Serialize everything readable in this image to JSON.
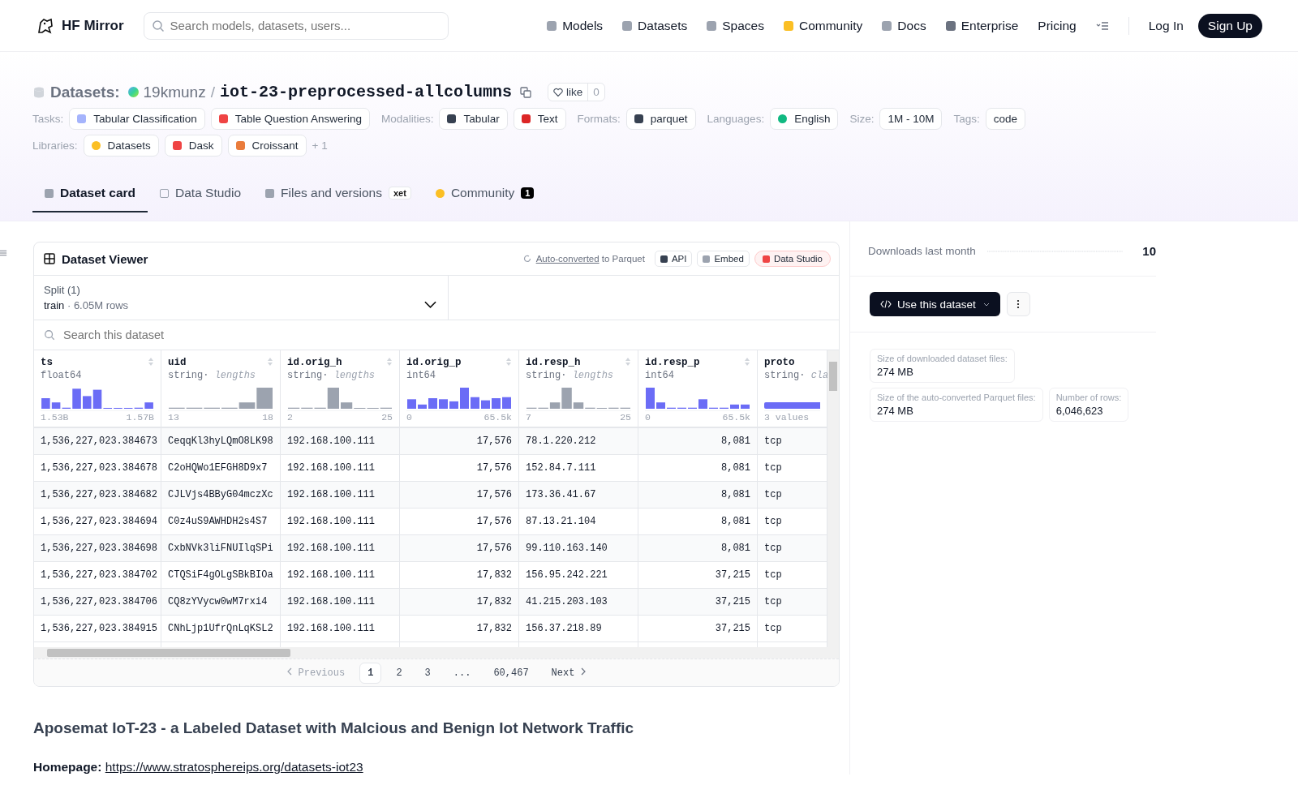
{
  "nav": {
    "brand": "HF Mirror",
    "search": {
      "placeholder": "Search models, datasets, users..."
    },
    "links": [
      {
        "label": "Models",
        "kind": "cube"
      },
      {
        "label": "Datasets",
        "kind": "db"
      },
      {
        "label": "Spaces",
        "kind": "grid"
      },
      {
        "label": "Community",
        "kind": "hand"
      },
      {
        "label": "Docs",
        "kind": "book"
      },
      {
        "label": "Enterprise",
        "kind": "ent"
      },
      {
        "label": "Pricing",
        "kind": "plain"
      }
    ],
    "login": "Log In",
    "signup": "Sign Up"
  },
  "repo": {
    "section": "Datasets:",
    "owner": "19kmunz",
    "separator": "/",
    "name": "iot-23-preprocessed-allcolumns",
    "like": "like",
    "likes": "0"
  },
  "tag_rows": [
    [
      {
        "label": "Tasks:",
        "tags": [
          {
            "label": "Tabular Classification",
            "kind": "classify"
          },
          {
            "label": "Table Question Answering",
            "kind": "tableqa"
          }
        ]
      },
      {
        "label": "Modalities:",
        "tags": [
          {
            "label": "Tabular",
            "kind": "tabular"
          },
          {
            "label": "Text",
            "kind": "text"
          }
        ]
      },
      {
        "label": "Formats:",
        "tags": [
          {
            "label": "parquet",
            "kind": "parquet"
          }
        ]
      },
      {
        "label": "Languages:",
        "tags": [
          {
            "label": "English",
            "kind": "globe"
          }
        ]
      },
      {
        "label": "Size:",
        "tags": [
          {
            "label": "1M - 10M",
            "kind": "plain"
          }
        ]
      },
      {
        "label": "Tags:",
        "tags": [
          {
            "label": "code",
            "kind": "plain"
          }
        ]
      }
    ],
    [
      {
        "label": "Libraries:",
        "tags": [
          {
            "label": "Datasets",
            "kind": "hug"
          },
          {
            "label": "Dask",
            "kind": "dask"
          },
          {
            "label": "Croissant",
            "kind": "croissant"
          }
        ],
        "more": "+ 1"
      }
    ]
  ],
  "tabs": [
    {
      "label": "Dataset card",
      "kind": "cube",
      "selected": true
    },
    {
      "label": "Data Studio",
      "kind": "table",
      "selected": false
    },
    {
      "label": "Files and versions",
      "kind": "files",
      "badge": "xet",
      "selected": false
    },
    {
      "label": "Community",
      "kind": "hand",
      "badge": "1",
      "selected": false
    }
  ],
  "viewer": {
    "title": "Dataset Viewer",
    "converted_link": "Auto-converted",
    "converted_text": "to Parquet",
    "buttons": [
      {
        "label": "API",
        "kind": "code"
      },
      {
        "label": "Embed",
        "kind": "embed"
      },
      {
        "label": "Data Studio",
        "kind": "studio"
      }
    ],
    "separator": "·",
    "split": {
      "label": "Split (1)",
      "name": "train",
      "rows": "6.05M rows"
    },
    "search": {
      "placeholder": "Search this dataset"
    },
    "columns": [
      {
        "name": "ts",
        "dtype": "float64",
        "kind": "float",
        "min": "1.53B",
        "max": "1.57B"
      },
      {
        "name": "uid",
        "dtype": "string",
        "stat": "lengths",
        "kind": "string",
        "min": "13",
        "max": "18"
      },
      {
        "name": "id.orig_h",
        "dtype": "string",
        "stat": "lengths",
        "kind": "string",
        "min": "2",
        "max": "25"
      },
      {
        "name": "id.orig_p",
        "dtype": "int64",
        "kind": "int",
        "min": "0",
        "max": "65.5k"
      },
      {
        "name": "id.resp_h",
        "dtype": "string",
        "stat": "lengths",
        "kind": "string",
        "min": "7",
        "max": "25"
      },
      {
        "name": "id.resp_p",
        "dtype": "int64",
        "kind": "int",
        "min": "0",
        "max": "65.5k"
      },
      {
        "name": "proto",
        "dtype": "string",
        "stat": "cla",
        "kind": "class",
        "min": "3 values"
      }
    ],
    "rows": [
      [
        "1,536,227,023.384673",
        "CeqqKl3hyLQmO8LK98",
        "192.168.100.111",
        "17,576",
        "78.1.220.212",
        "8,081",
        "tcp"
      ],
      [
        "1,536,227,023.384678",
        "C2oHQWo1EFGH8D9x7",
        "192.168.100.111",
        "17,576",
        "152.84.7.111",
        "8,081",
        "tcp"
      ],
      [
        "1,536,227,023.384682",
        "CJLVjs4BByG04mczXc",
        "192.168.100.111",
        "17,576",
        "173.36.41.67",
        "8,081",
        "tcp"
      ],
      [
        "1,536,227,023.384694",
        "C0z4uS9AWHDH2s4S7",
        "192.168.100.111",
        "17,576",
        "87.13.21.104",
        "8,081",
        "tcp"
      ],
      [
        "1,536,227,023.384698",
        "CxbNVk3liFNUIlqSPi",
        "192.168.100.111",
        "17,576",
        "99.110.163.140",
        "8,081",
        "tcp"
      ],
      [
        "1,536,227,023.384702",
        "CTQSiF4gOLgSBkBIOa",
        "192.168.100.111",
        "17,832",
        "156.95.242.221",
        "37,215",
        "tcp"
      ],
      [
        "1,536,227,023.384706",
        "CQ8zYVycw0wM7rxi4",
        "192.168.100.111",
        "17,832",
        "41.215.203.103",
        "37,215",
        "tcp"
      ],
      [
        "1,536,227,023.384915",
        "CNhLjp1UfrQnLqKSL2",
        "192.168.100.111",
        "17,832",
        "156.37.218.89",
        "37,215",
        "tcp"
      ]
    ],
    "pagination": {
      "previous": "Previous",
      "pages": [
        {
          "label": "1",
          "selected": true
        },
        {
          "label": "2",
          "selected": false
        },
        {
          "label": "3",
          "selected": false
        },
        {
          "label": "...",
          "selected": false
        },
        {
          "label": "60,467",
          "selected": false
        }
      ],
      "next": "Next"
    }
  },
  "sidebar": {
    "downloads_label": "Downloads last month",
    "downloads": "10",
    "use_button": "Use this dataset",
    "stats": [
      [
        {
          "label": "Size of downloaded dataset files:",
          "value": "274 MB"
        }
      ],
      [
        {
          "label": "Size of the auto-converted Parquet files:",
          "value": "274 MB"
        },
        {
          "label": "Number of rows:",
          "value": "6,046,623"
        }
      ]
    ]
  },
  "card": {
    "heading": "Aposemat IoT-23 - a Labeled Dataset with Malcious and Benign Iot Network Traffic",
    "homepage_label": "Homepage:",
    "homepage_link": "https://www.stratosphereips.org/datasets-iot23"
  }
}
